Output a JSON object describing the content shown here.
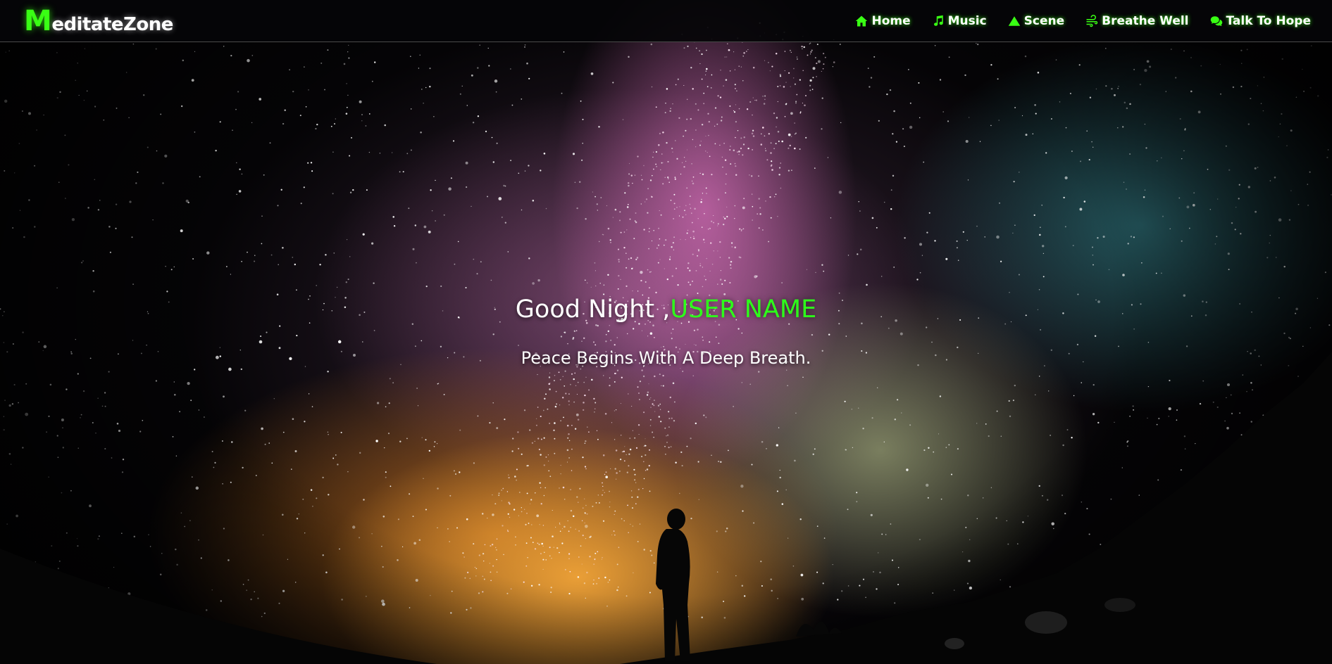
{
  "logo": {
    "first_letter": "M",
    "rest": "editateZone"
  },
  "nav": {
    "items": [
      {
        "label": "Home",
        "icon": "home-icon"
      },
      {
        "label": "Music",
        "icon": "music-note-icon"
      },
      {
        "label": "Scene",
        "icon": "mountain-icon"
      },
      {
        "label": "Breathe Well",
        "icon": "wind-icon"
      },
      {
        "label": "Talk To Hope",
        "icon": "chat-bubbles-icon"
      }
    ]
  },
  "hero": {
    "greeting": "Good Night ,",
    "user_name": "USER NAME",
    "tagline": "Peace Begins With A Deep Breath."
  },
  "colors": {
    "accent": "#39ff14",
    "text": "#ffffff",
    "nav_bg": "#050508"
  }
}
